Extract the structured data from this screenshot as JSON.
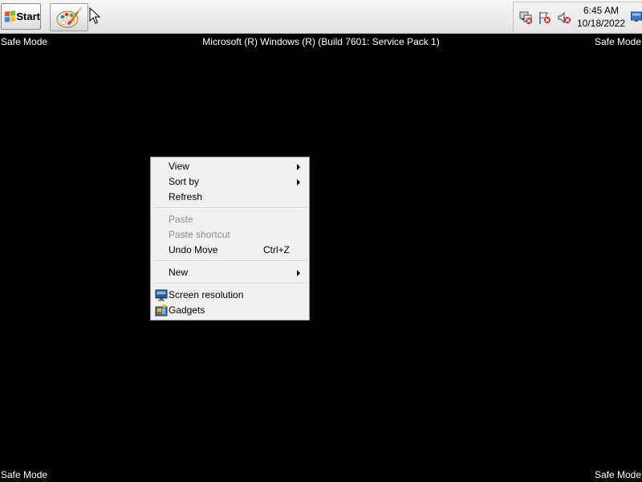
{
  "taskbar": {
    "start_label": "Start",
    "pinned_app_icon": "paint-icon",
    "clock": {
      "time": "6:45 AM",
      "date": "10/18/2022"
    },
    "tray_icons": [
      "network-disconnected-icon",
      "action-center-flag-icon",
      "volume-muted-icon"
    ]
  },
  "desktop": {
    "safe_mode_label": "Safe Mode",
    "build_text": "Microsoft (R) Windows (R) (Build 7601: Service Pack 1)"
  },
  "context_menu": {
    "items": [
      {
        "label": "View",
        "submenu": true,
        "enabled": true
      },
      {
        "label": "Sort by",
        "submenu": true,
        "enabled": true
      },
      {
        "label": "Refresh",
        "enabled": true
      },
      {
        "label": "Paste",
        "enabled": false
      },
      {
        "label": "Paste shortcut",
        "enabled": false
      },
      {
        "label": "Undo Move",
        "shortcut": "Ctrl+Z",
        "enabled": true
      },
      {
        "label": "New",
        "submenu": true,
        "enabled": true
      },
      {
        "label": "Screen resolution",
        "icon": "screen-resolution-icon",
        "enabled": true
      },
      {
        "label": "Gadgets",
        "icon": "gadgets-icon",
        "enabled": true
      }
    ]
  },
  "colors": {
    "desktop_background": "#000000",
    "menu_background": "#f0f0f0",
    "disabled_text": "#8d8d8d"
  }
}
